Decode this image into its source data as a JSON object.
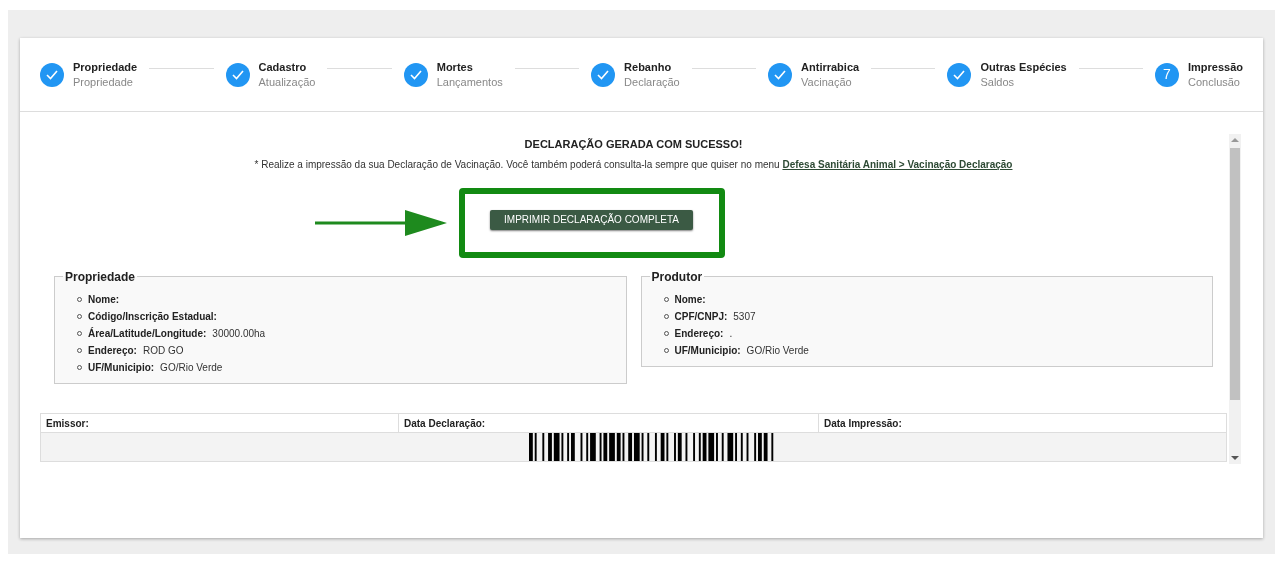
{
  "steps": [
    {
      "title": "Propriedade",
      "subtitle": "Propriedade",
      "done": true
    },
    {
      "title": "Cadastro",
      "subtitle": "Atualização",
      "done": true
    },
    {
      "title": "Mortes",
      "subtitle": "Lançamentos",
      "done": true
    },
    {
      "title": "Rebanho",
      "subtitle": "Declaração",
      "done": true
    },
    {
      "title": "Antirrabica",
      "subtitle": "Vacinação",
      "done": true
    },
    {
      "title": "Outras Espécies",
      "subtitle": "Saldos",
      "done": true
    },
    {
      "title": "Impressão",
      "subtitle": "Conclusão",
      "done": false,
      "number": "7"
    }
  ],
  "success": {
    "title": "DECLARAÇÃO GERADA COM SUCESSO!",
    "message": "* Realize a impressão da sua Declaração de Vacinação. Você também poderá consulta-la sempre que quiser no menu",
    "link": "Defesa Sanitária Animal > Vacinação Declaração"
  },
  "print_button": "IMPRIMIR DECLARAÇÃO COMPLETA",
  "panels": [
    {
      "legend": "Propriedade",
      "items": [
        {
          "label": "Nome:"
        },
        {
          "label": "Código/Inscrição Estadual:"
        },
        {
          "label": "Área/Latitude/Longitude:",
          "value": "30000.00ha"
        },
        {
          "label": "Endereço:",
          "value": "ROD GO"
        },
        {
          "label": "UF/Municipio:",
          "value": "GO/Rio Verde"
        }
      ]
    },
    {
      "legend": "Produtor",
      "items": [
        {
          "label": "Nome:"
        },
        {
          "label": "CPF/CNPJ:",
          "value": "5307"
        },
        {
          "label": "Endereço:",
          "value": "."
        },
        {
          "label": "UF/Municipio:",
          "value": "GO/Rio Verde"
        }
      ]
    }
  ],
  "table": {
    "columns": [
      "Emissor:",
      "Data Declaração:",
      "Data Impressão:"
    ]
  }
}
